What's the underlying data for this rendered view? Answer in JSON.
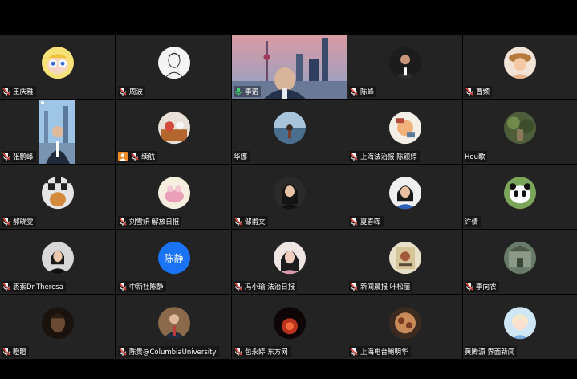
{
  "meeting": {
    "participants": [
      {
        "name": "王庆雅",
        "avatar": "cartoon-girl",
        "mic": "muted"
      },
      {
        "name": "周波",
        "avatar": "sketch-portrait",
        "mic": "muted"
      },
      {
        "name": "李诺",
        "avatar": "video-city-skyline",
        "mic": "active",
        "speaking": true
      },
      {
        "name": "陈峰",
        "avatar": "man-dark",
        "mic": "muted"
      },
      {
        "name": "曹频",
        "avatar": "girl-hat",
        "mic": "muted"
      },
      {
        "name": "张鹏峰",
        "avatar": "video-portrait",
        "mic": "muted"
      },
      {
        "name": "续航",
        "avatar": "food-desk",
        "mic": "muted",
        "host": true
      },
      {
        "name": "华娜",
        "avatar": "woman-sea",
        "mic": "none"
      },
      {
        "name": "上海法治报 陈颖婷",
        "avatar": "news-art",
        "mic": "muted"
      },
      {
        "name": "Hou歌",
        "avatar": "forest",
        "mic": "none"
      },
      {
        "name": "郝晓雯",
        "avatar": "cat-checker",
        "mic": "muted"
      },
      {
        "name": "刘雪妍 解放日报",
        "avatar": "pink-cake",
        "mic": "muted"
      },
      {
        "name": "邹甫文",
        "avatar": "woman-dark",
        "mic": "muted"
      },
      {
        "name": "夏春晖",
        "avatar": "woman-blue",
        "mic": "muted"
      },
      {
        "name": "许倩",
        "avatar": "panda",
        "mic": "none"
      },
      {
        "name": "裘索Dr.Theresa",
        "avatar": "woman-suit",
        "mic": "muted"
      },
      {
        "name": "中新社陈静",
        "avatar": "initials",
        "initials": "陈静",
        "mic": "muted"
      },
      {
        "name": "冯小瑜 法治日报",
        "avatar": "woman-pink",
        "mic": "muted"
      },
      {
        "name": "新闻晨报 叶松丽",
        "avatar": "poster",
        "mic": "muted"
      },
      {
        "name": "李向农",
        "avatar": "temple",
        "mic": "muted"
      },
      {
        "name": "瞪瞪",
        "avatar": "night-portrait",
        "mic": "muted"
      },
      {
        "name": "陈贵@ColumbiaUniversity",
        "avatar": "man-suit",
        "mic": "muted"
      },
      {
        "name": "包永婷 东方网",
        "avatar": "red-light",
        "mic": "muted"
      },
      {
        "name": "上海电台鲍明华",
        "avatar": "meat-plate",
        "mic": "muted"
      },
      {
        "name": "黄腾源 界面新闻",
        "avatar": "anime-girl",
        "mic": "none"
      }
    ]
  },
  "colors": {
    "tile_bg": "#232323",
    "speaking_border": "#3ed46a",
    "muted_icon": "#e0443e",
    "host_badge": "#f08a24",
    "initials_bg": "#1a73f5"
  }
}
